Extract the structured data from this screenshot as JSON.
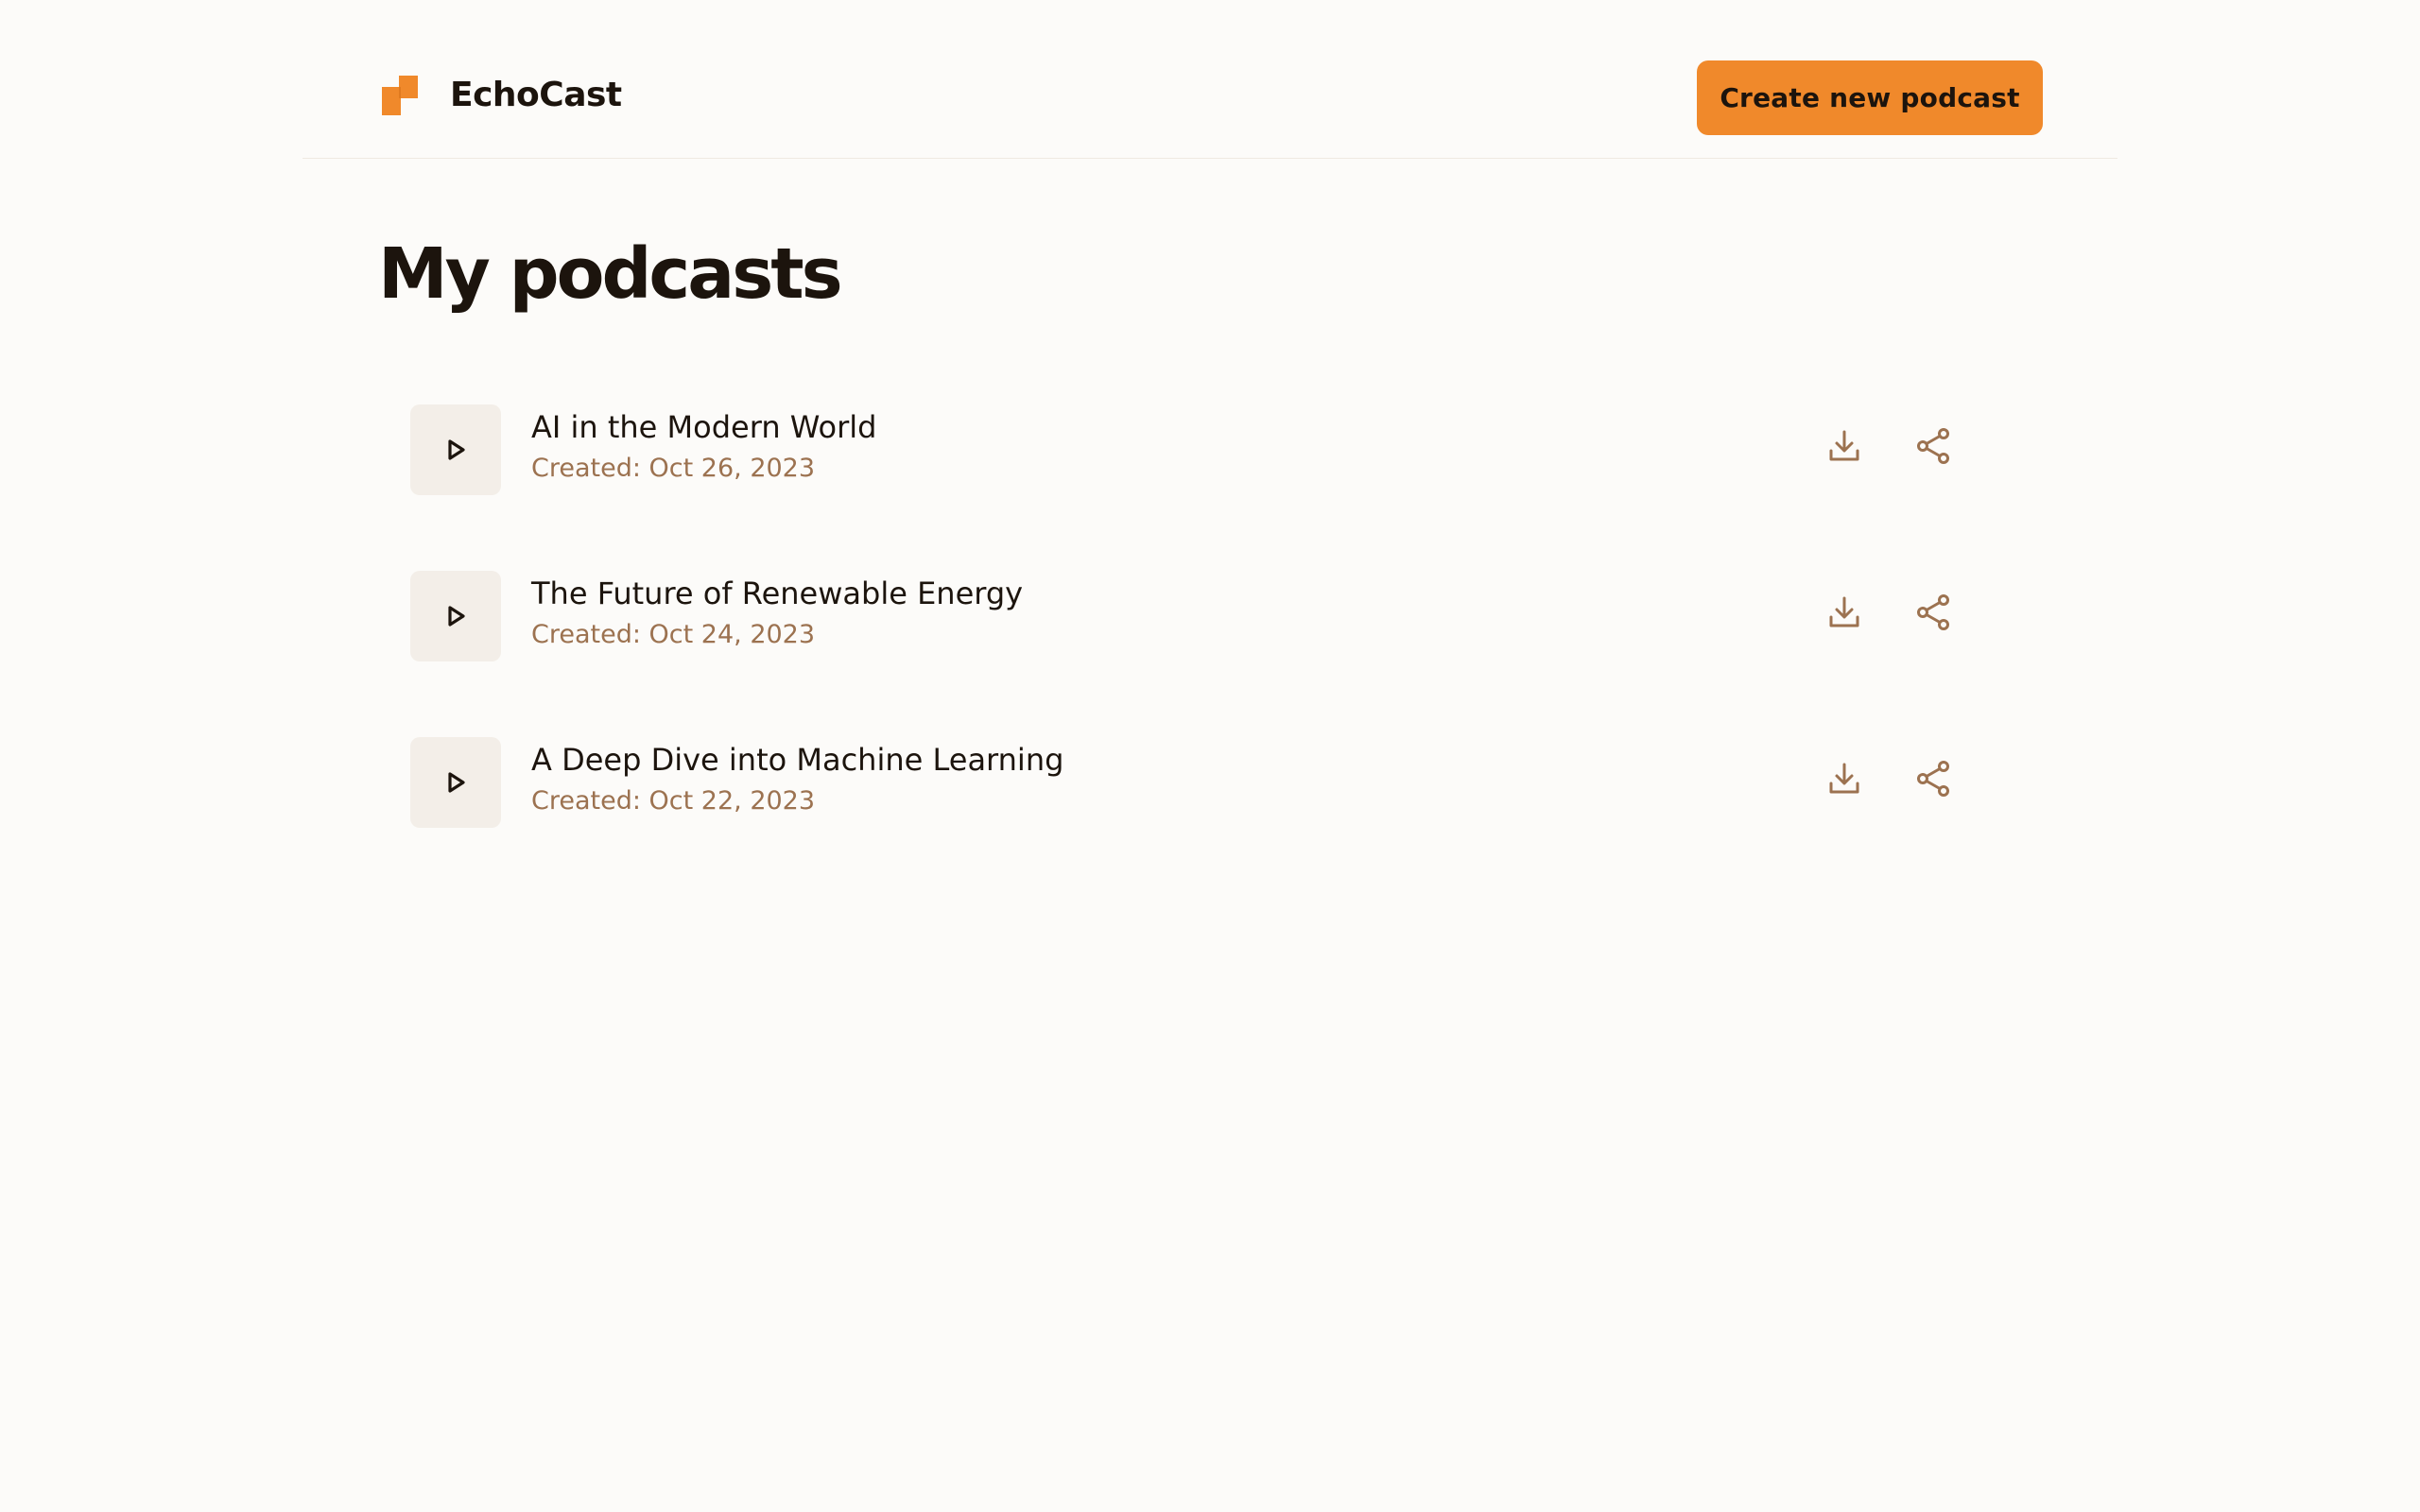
{
  "app": {
    "name": "EchoCast",
    "brand_color": "#f0892b"
  },
  "header": {
    "create_button_label": "Create new podcast"
  },
  "main": {
    "title": "My podcasts",
    "podcasts": [
      {
        "title": "AI in the Modern World",
        "created": "Created: Oct 26, 2023"
      },
      {
        "title": "The Future of Renewable Energy",
        "created": "Created: Oct 24, 2023"
      },
      {
        "title": "A Deep Dive into Machine Learning",
        "created": "Created: Oct 22, 2023"
      }
    ]
  },
  "icons": {
    "logo": "echocast-logo-icon",
    "play": "play-icon",
    "download": "download-icon",
    "share": "share-icon"
  },
  "colors": {
    "background": "#fcfbf9",
    "text": "#1c140d",
    "muted": "#9c7250",
    "tile": "#f3eee8",
    "accent": "#f0892b"
  }
}
